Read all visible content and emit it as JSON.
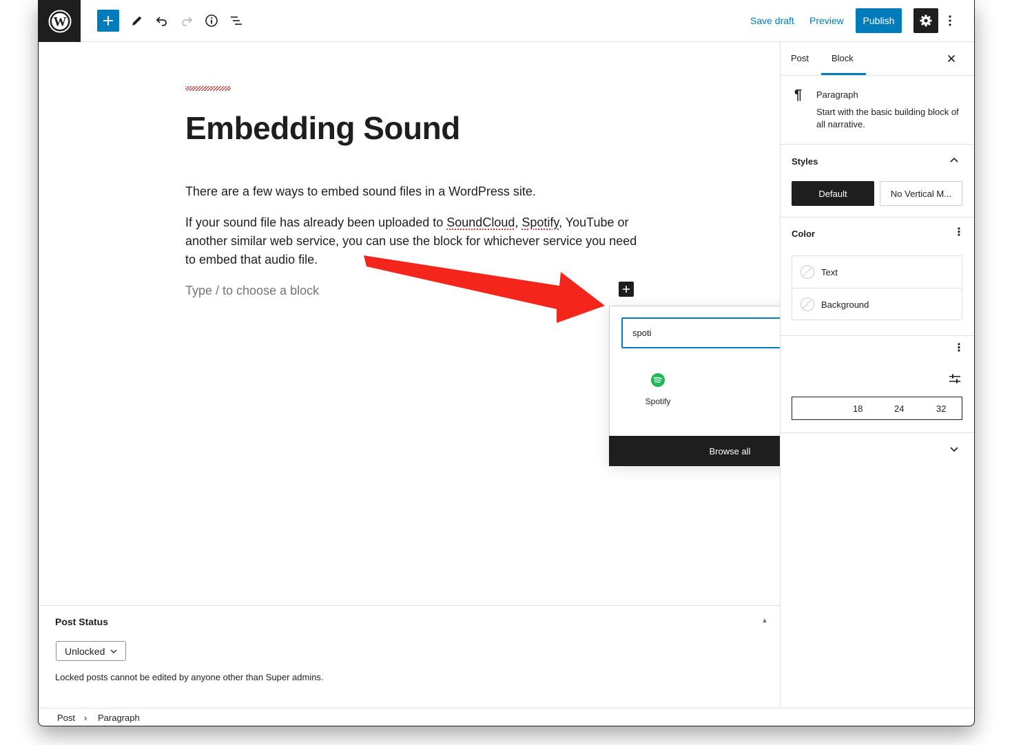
{
  "toolbar": {
    "save_draft": "Save draft",
    "preview": "Preview",
    "publish": "Publish"
  },
  "editor": {
    "title": "Embedding Sound",
    "para1": "There are a few ways to embed sound files in a WordPress site.",
    "para2_a": "If your sound file has already been uploaded to ",
    "para2_link1": "SoundCloud",
    "para2_sep": ", ",
    "para2_link2": "Spotify",
    "para2_b": ", YouTube or another similar web service, you can use the block for whichever service you need to embed that audio file.",
    "placeholder": "Type / to choose a block"
  },
  "inserter": {
    "search_value": "spoti",
    "result_label": "Spotify",
    "browse_all": "Browse all"
  },
  "post_status": {
    "title": "Post Status",
    "select_value": "Unlocked",
    "description": "Locked posts cannot be edited by anyone other than Super admins."
  },
  "breadcrumb": {
    "items": [
      "Post",
      "Paragraph"
    ]
  },
  "sidebar": {
    "tabs": [
      "Post",
      "Block"
    ],
    "block_title": "Paragraph",
    "block_desc": "Start with the basic building block of all narrative.",
    "styles_title": "Styles",
    "style_default": "Default",
    "style_other": "No Vertical M...",
    "color_title": "Color",
    "color_text": "Text",
    "color_background": "Background",
    "font_sizes": [
      "18",
      "24",
      "32"
    ]
  },
  "colors": {
    "accent": "#007cba",
    "dark": "#1e1e1e",
    "spotify": "#1db954",
    "arrow": "#f4261b"
  }
}
